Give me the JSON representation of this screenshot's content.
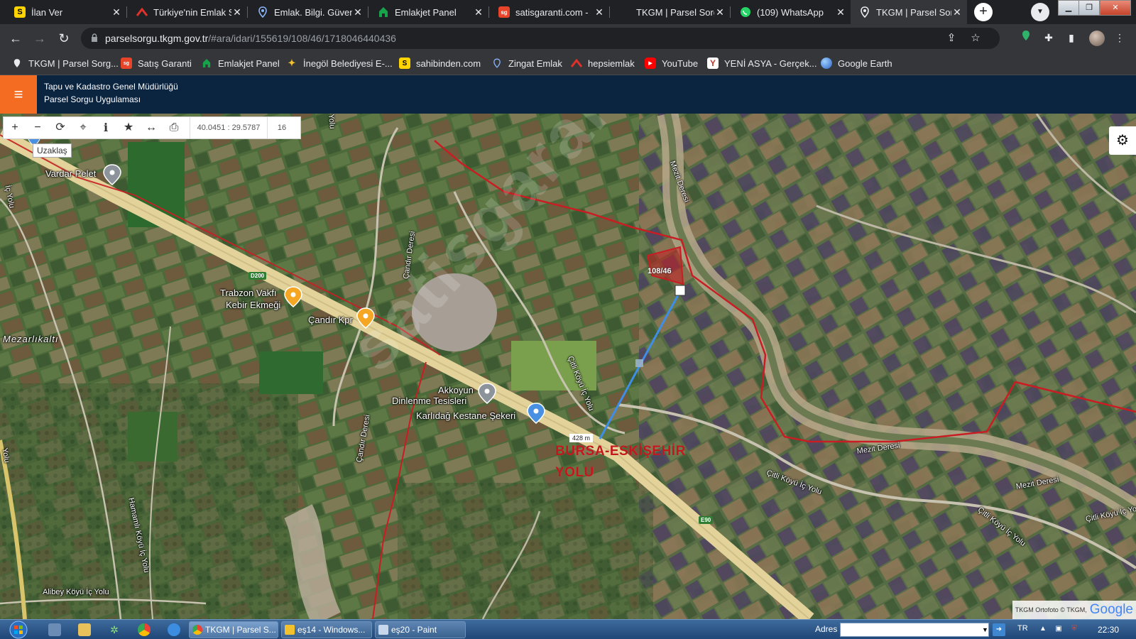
{
  "browser": {
    "tabs": [
      {
        "title": "İlan Ver",
        "favicon_color": "#ffd400",
        "favicon_glyph": "S"
      },
      {
        "title": "Türkiye'nin Emlak S",
        "favicon_color": "#e0312a",
        "favicon_glyph": ""
      },
      {
        "title": "Emlak. Bilgi. Güven",
        "favicon_color": "#8ab4f8",
        "favicon_glyph": ""
      },
      {
        "title": "Emlakjet Panel",
        "favicon_color": "#17a34a",
        "favicon_glyph": ""
      },
      {
        "title": "satisgaranti.com -",
        "favicon_color": "#e8442a",
        "favicon_glyph": "sg"
      },
      {
        "title": "TKGM | Parsel Sorg",
        "favicon_color": "",
        "favicon_glyph": ""
      },
      {
        "title": "(109) WhatsApp",
        "favicon_color": "#25d366",
        "favicon_glyph": ""
      },
      {
        "title": "TKGM | Parsel Sorg",
        "favicon_color": "#8ab4f8",
        "favicon_glyph": ""
      }
    ],
    "active_tab_index": 7,
    "url_host": "parselsorgu.tkgm.gov.tr",
    "url_path": "/#ara/idari/155619/108/46/1718046440436",
    "bookmarks": [
      {
        "label": "TKGM | Parsel Sorg...",
        "color": "#e8eaed"
      },
      {
        "label": "Satış Garanti",
        "color": "#e8442a"
      },
      {
        "label": "Emlakjet Panel",
        "color": "#17a34a"
      },
      {
        "label": "İnegöl Belediyesi E-...",
        "color": "#f2c12e"
      },
      {
        "label": "sahibinden.com",
        "color": "#ffd400"
      },
      {
        "label": "Zingat Emlak",
        "color": "#8ab4f8"
      },
      {
        "label": "hepsiemlak",
        "color": "#e0312a"
      },
      {
        "label": "YouTube",
        "color": "#ff0000"
      },
      {
        "label": "YENİ ASYA - Gerçek...",
        "color": "#c0392b"
      },
      {
        "label": "Google Earth",
        "color": "#4285f4"
      }
    ]
  },
  "app": {
    "title_line1": "Tapu ve Kadastro Genel Müdürlüğü",
    "title_line2": "Parsel Sorgu Uygulaması"
  },
  "map": {
    "coordinates": "40.0451 : 29.5787",
    "zoom": "16",
    "tooltip": "Uzaklaş",
    "parcel_label": "108/46",
    "measurement": "428 m",
    "annotation_line1": "BURSA-ESKİŞEHİR",
    "annotation_line2": "YOLU",
    "shield_d200": "D200",
    "shield_e90": "E90",
    "attribution": "TKGM Ortofoto © TKGM,",
    "google": "Google",
    "watermark": "satisgaranti",
    "labels": [
      {
        "text": "Vardar Pelet",
        "name": "poi-vardar-pelet"
      },
      {
        "text": "Trabzon Vakfı",
        "name": "poi-trabzon-vakfi"
      },
      {
        "text": "Kebir Ekmeği",
        "name": "poi-kebir-ekmegi"
      },
      {
        "text": "Çandır Kpr",
        "name": "poi-candir-kpr"
      },
      {
        "text": "Akkoyun",
        "name": "poi-akkoyun"
      },
      {
        "text": "Dinlenme Tesisleri",
        "name": "poi-dinlenme-tesisleri"
      },
      {
        "text": "Karlıdağ Kestane Şekeri",
        "name": "poi-karlidag"
      },
      {
        "text": "Mezarlıkaltı",
        "name": "place-mezarlikalti"
      },
      {
        "text": "Çandır Deresi",
        "name": "stream-candir-1"
      },
      {
        "text": "Çandır Deresi",
        "name": "stream-candir-2"
      },
      {
        "text": "Mezit Deresi",
        "name": "stream-mezit-1"
      },
      {
        "text": "Mezit Deresi",
        "name": "stream-mezit-2"
      },
      {
        "text": "Mezit Deresi",
        "name": "stream-mezit-3"
      },
      {
        "text": "Çitli Köyü İç Yolu",
        "name": "road-citli-1"
      },
      {
        "text": "Çitli Köyü İç Yolu",
        "name": "road-citli-2"
      },
      {
        "text": "Çitli Köyü İç Yolu",
        "name": "road-citli-3"
      },
      {
        "text": "Çitli Köyü İç Yolu",
        "name": "road-citli-4"
      },
      {
        "text": "Hamamlı Köyü İç Yolu",
        "name": "road-hamamli"
      },
      {
        "text": "Alibey Köyü İç Yolu",
        "name": "road-alibey"
      },
      {
        "text": "İç Yolu",
        "name": "road-ic-yolu-left"
      },
      {
        "text": "Yolu",
        "name": "road-yolu-bottom-left"
      },
      {
        "text": "Yolu",
        "name": "road-yolu-top"
      }
    ]
  },
  "taskbar": {
    "windows": [
      {
        "label": "TKGM | Parsel S...",
        "active": true,
        "color": "#4285f4"
      },
      {
        "label": "eş14 - Windows...",
        "active": false,
        "color": "#f2c12e"
      },
      {
        "label": "eş20 - Paint",
        "active": false,
        "color": "#c7d7ec"
      }
    ],
    "address_label": "Adres",
    "address_value": "",
    "language": "TR",
    "time": "22:30"
  }
}
